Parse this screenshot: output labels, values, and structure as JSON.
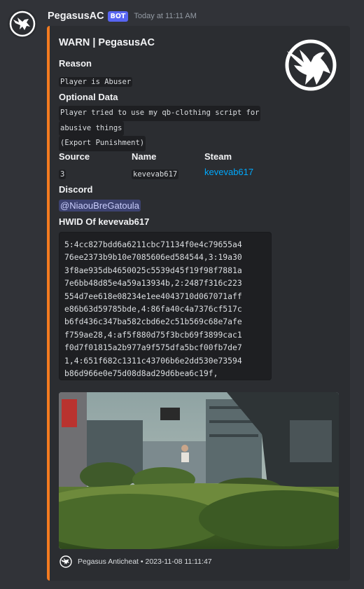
{
  "message": {
    "username": "PegasusAC",
    "bot_tag": "BOT",
    "timestamp": "Today at 11:11 AM"
  },
  "embed": {
    "accent_color": "#f47b20",
    "title": "WARN | PegasusAC",
    "reason": {
      "name": "Reason",
      "value": "Player is Abuser"
    },
    "optional_data": {
      "name": "Optional Data",
      "lines": [
        "Player tried to use my qb-clothing script for",
        "abusive things",
        "(Export Punishment)"
      ]
    },
    "source": {
      "name": "Source",
      "value": "3"
    },
    "player_name": {
      "name": "Name",
      "value": "kevevab617"
    },
    "steam": {
      "name": "Steam",
      "value": "kevevab617"
    },
    "discord": {
      "name": "Discord",
      "value": "@NiaouBreGatoula"
    },
    "hwid": {
      "name": "HWID Of kevevab617",
      "lines": [
        "5:4cc827bdd6a6211cbc71134f0e4c79655a4",
        "76ee2373b9b10e7085606ed584544,3:19a30",
        "3f8ae935db4650025c5539d45f19f98f7881a",
        "7e6bb48d85e4a59a13934b,2:2487f316c223",
        "554d7ee618e08234e1ee4043710d067071aff",
        "e86b63d59785bde,4:86fa40c4a7376cf517c",
        "b6fd436c347ba582cbd6e2c51b569c68e7afe",
        "f759ae28,4:af5f880d75f3bcb69f3899cac1",
        "f0d7f01815a2b977a9f575dfa5bcf00fb7de7",
        "1,4:651f682c1311c43706b6e2dd530e73594",
        "b86d966e0e75d08d8ad29d6bea6c19f,"
      ]
    },
    "image": {
      "description_icon": "screenshot-image"
    },
    "footer": {
      "text": "Pegasus Anticheat • 2023-11-08 11:11:47"
    }
  }
}
